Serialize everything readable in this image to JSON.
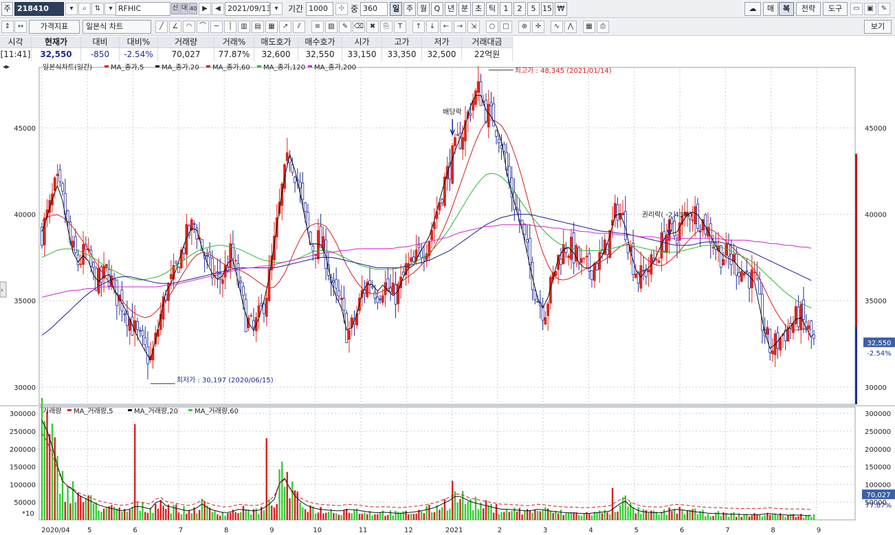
{
  "toolbar": {
    "market_label": "주",
    "code": "218410",
    "name": "RFHIC",
    "name_tags": [
      "신",
      "대",
      "40"
    ],
    "date": "2021/09/13",
    "period_label": "기간",
    "period_value": "1000",
    "count_label": "중",
    "count_value": "360",
    "intervals": [
      "일",
      "주",
      "월",
      "Q",
      "년",
      "분",
      "초",
      "틱",
      "1",
      "2",
      "5",
      "15",
      "₩"
    ],
    "active_interval": "일",
    "right_buttons": [
      "매",
      "복",
      "전략",
      "도구"
    ],
    "icons": [
      "search-icon",
      "sort-icon",
      "dropdown-icon",
      "play-icon",
      "prev-icon",
      "dropdown-icon",
      "spin-icon",
      "cloud-icon",
      "folder-icon",
      "save-icon",
      "settings-icon"
    ]
  },
  "toolbar2": {
    "chart_type": "가격지표",
    "chart_style": "일본식 차트",
    "view_label": "보기",
    "tool_icons": [
      "line-tool-icon",
      "angle-tool-icon",
      "fan-tool-icon",
      "arc-tool-icon",
      "hline-icon",
      "vline-icon",
      "grid-icon",
      "cycle-icon",
      "channel-icon",
      "ray-icon",
      "parallel-icon",
      "multi-line-icon",
      "fibo-icon",
      "pencil-icon",
      "eraser-icon",
      "delete-icon",
      "copy-icon",
      "text-icon",
      "up-arrow-icon",
      "down-arrow-icon",
      "left-arrow-icon",
      "right-arrow-icon",
      "export-icon",
      "circle-icon",
      "rect-icon",
      "zoom-icon",
      "crosshair-icon",
      "wave-icon",
      "pattern-icon",
      "print-icon",
      "print-preview-icon"
    ]
  },
  "quote": {
    "headers": [
      "시각",
      "현재가",
      "대비",
      "대비%",
      "거래량",
      "거래%",
      "매도호가",
      "매수호가",
      "시가",
      "고가",
      "저가",
      "거래대금"
    ],
    "values": [
      "[11:41]",
      "32,550",
      "-850",
      "-2.54%",
      "70,027",
      "77.87%",
      "32,600",
      "32,550",
      "33,150",
      "33,350",
      "32,500",
      "22억원"
    ]
  },
  "colors": {
    "up": "#e0241a",
    "down": "#1b2c9c",
    "ma5": "#d21e1e",
    "ma20": "#111111",
    "ma60": "#c0161a",
    "ma120": "#2ab82a",
    "ma200": "#1a1a8c",
    "ma_pink": "#d322d3",
    "vol_up": "#d82020",
    "vol_down": "#33cc33"
  },
  "price_legend": {
    "title": "일본식차트(일간)",
    "items": [
      "MA_종가,5",
      "MA_종가,20",
      "MA_종가,60",
      "MA_종가,120",
      "MA_종가,200"
    ]
  },
  "volume_legend": {
    "title": "거래량",
    "items": [
      "MA_거래량,5",
      "MA_거래량,20",
      "MA_거래량,60"
    ]
  },
  "chart_data": {
    "type": "candlestick",
    "price_axis": {
      "ticks": [
        30000,
        35000,
        40000,
        45000
      ],
      "labels": [
        "30000",
        "35000",
        "40000",
        "45000"
      ],
      "ylim": [
        29000,
        48500
      ]
    },
    "volume_axis": {
      "ticks": [
        50000,
        100000,
        150000,
        200000,
        250000,
        300000
      ],
      "labels": [
        "50000",
        "100000",
        "150000",
        "200000",
        "250000",
        "300000"
      ],
      "ylim": [
        0,
        310000
      ],
      "multiplier_label": "*10"
    },
    "x_labels": [
      "2020/04",
      "5",
      "6",
      "7",
      "8",
      "9",
      "10",
      "11",
      "12",
      "2021",
      "2",
      "3",
      "4",
      "5",
      "6",
      "7",
      "8",
      "9"
    ],
    "close_path": [
      39000,
      40200,
      41800,
      40600,
      38000,
      37200,
      37800,
      36500,
      36000,
      36800,
      35500,
      34900,
      34000,
      33000,
      32200,
      31500,
      33500,
      35500,
      36200,
      37600,
      38800,
      39500,
      38000,
      36800,
      36200,
      36500,
      37800,
      36000,
      34000,
      33200,
      34200,
      35800,
      38500,
      41500,
      43500,
      42200,
      40000,
      38000,
      38500,
      37600,
      35500,
      34800,
      33000,
      33800,
      35500,
      36200,
      35500,
      36000,
      35200,
      35600,
      36800,
      37000,
      37900,
      38500,
      39800,
      41500,
      42800,
      44000,
      45000,
      46500,
      47200,
      46000,
      45500,
      44500,
      42000,
      40500,
      39000,
      37000,
      35200,
      34400,
      36000,
      37600,
      38200,
      37800,
      37000,
      36800,
      37200,
      37500,
      38800,
      40400,
      39500,
      37500,
      36200,
      36800,
      37200,
      38200,
      39000,
      38800,
      39600,
      40200,
      40000,
      39400,
      38600,
      37800,
      37500,
      37300,
      36800,
      36500,
      36000,
      33500,
      32200,
      32600,
      33200,
      33600,
      34200,
      33400,
      32550
    ],
    "ma20": [
      39600,
      39900,
      40000,
      39800,
      39400,
      38800,
      38200,
      37500,
      36800,
      36200,
      35600,
      35000,
      34500,
      34200,
      34000,
      34100,
      34500,
      35000,
      35600,
      36300,
      37000,
      37600,
      37800,
      37700,
      37400,
      37100,
      36900,
      36800,
      36600,
      36300,
      36000,
      35700,
      35800,
      36300,
      37200,
      38200,
      39000,
      39400,
      39500,
      39300,
      38700,
      37800,
      36900,
      36200,
      35700,
      35400,
      35400,
      35600,
      35800,
      36000,
      36300,
      36600,
      37000,
      37500,
      38200,
      39000,
      40000,
      41200,
      42400,
      43600,
      44700,
      45400,
      45500,
      45200,
      44500,
      43400,
      42000,
      40400,
      38800,
      37500,
      36600,
      36200,
      36200,
      36400,
      36700,
      36900,
      37100,
      37300,
      37600,
      38000,
      38300,
      38200,
      37800,
      37400,
      37100,
      37000,
      37200,
      37600,
      38100,
      38600,
      39000,
      39200,
      39100,
      38800,
      38400,
      38000,
      37600,
      37200,
      36700,
      35900,
      35000,
      34200,
      33600,
      33300,
      33300,
      33400,
      33300
    ],
    "ma60": [
      37500,
      37700,
      37900,
      38000,
      38000,
      37900,
      37700,
      37500,
      37200,
      36900,
      36700,
      36500,
      36300,
      36200,
      36200,
      36300,
      36400,
      36600,
      36900,
      37200,
      37500,
      37800,
      38000,
      38100,
      38200,
      38200,
      38100,
      38000,
      37800,
      37600,
      37400,
      37300,
      37200,
      37200,
      37300,
      37400,
      37600,
      37800,
      37900,
      37900,
      37800,
      37600,
      37400,
      37200,
      37000,
      36900,
      36800,
      36800,
      36800,
      36900,
      37000,
      37200,
      37400,
      37700,
      38100,
      38600,
      39200,
      39900,
      40600,
      41300,
      41900,
      42300,
      42400,
      42200,
      41800,
      41200,
      40600,
      40000,
      39500,
      39000,
      38600,
      38300,
      38100,
      38000,
      37900,
      37900,
      37900,
      37900,
      38000,
      38100,
      38200,
      38200,
      38100,
      38000,
      37900,
      37800,
      37800,
      37800,
      37900,
      38000,
      38100,
      38200,
      38200,
      38100,
      38000,
      37800,
      37600,
      37400,
      37100,
      36700,
      36300,
      35900,
      35500,
      35200,
      34900,
      34700,
      34500
    ],
    "ma120": [
      33000,
      33300,
      33700,
      34100,
      34500,
      34900,
      35300,
      35600,
      35900,
      36100,
      36300,
      36400,
      36400,
      36300,
      36200,
      36100,
      36000,
      36000,
      36000,
      36100,
      36200,
      36300,
      36400,
      36500,
      36600,
      36700,
      36800,
      36900,
      36900,
      36900,
      36900,
      36900,
      36900,
      37000,
      37100,
      37200,
      37300,
      37400,
      37500,
      37500,
      37500,
      37400,
      37300,
      37200,
      37100,
      37000,
      36900,
      36900,
      36900,
      36900,
      37000,
      37100,
      37200,
      37300,
      37500,
      37700,
      37900,
      38200,
      38500,
      38800,
      39100,
      39400,
      39600,
      39800,
      39900,
      40000,
      40000,
      40000,
      39900,
      39800,
      39700,
      39600,
      39500,
      39400,
      39300,
      39200,
      39100,
      39000,
      39000,
      38900,
      38900,
      38800,
      38700,
      38600,
      38500,
      38400,
      38300,
      38200,
      38200,
      38200,
      38300,
      38400,
      38400,
      38400,
      38300,
      38200,
      38000,
      37900,
      37700,
      37500,
      37300,
      37100,
      36900,
      36700,
      36500,
      36300,
      36100
    ],
    "ma200": [
      35200,
      35300,
      35400,
      35500,
      35600,
      35600,
      35700,
      35700,
      35800,
      35800,
      35800,
      35800,
      35800,
      35800,
      35800,
      35800,
      35800,
      35900,
      35900,
      36000,
      36100,
      36200,
      36300,
      36400,
      36500,
      36600,
      36700,
      36800,
      36900,
      36900,
      37000,
      37000,
      37100,
      37200,
      37300,
      37400,
      37500,
      37600,
      37700,
      37800,
      37800,
      37900,
      37900,
      38000,
      38000,
      38000,
      38000,
      38000,
      38000,
      38100,
      38100,
      38200,
      38300,
      38400,
      38500,
      38600,
      38700,
      38900,
      39000,
      39100,
      39200,
      39300,
      39300,
      39400,
      39400,
      39400,
      39400,
      39400,
      39300,
      39300,
      39200,
      39200,
      39100,
      39100,
      39000,
      39000,
      38900,
      38900,
      38900,
      38800,
      38800,
      38800,
      38700,
      38700,
      38700,
      38600,
      38600,
      38600,
      38600,
      38600,
      38600,
      38600,
      38600,
      38600,
      38500,
      38500,
      38500,
      38500,
      38400,
      38400,
      38300,
      38300,
      38200,
      38200,
      38100,
      38100,
      38000
    ],
    "volume_path": [
      280000,
      240000,
      160000,
      100000,
      90000,
      70000,
      60000,
      50000,
      40000,
      35000,
      30000,
      25000,
      30000,
      40000,
      35000,
      30000,
      60000,
      40000,
      35000,
      30000,
      25000,
      30000,
      45000,
      30000,
      25000,
      20000,
      22000,
      30000,
      28000,
      25000,
      28000,
      40000,
      60000,
      130000,
      90000,
      60000,
      45000,
      35000,
      30000,
      28000,
      26000,
      25000,
      30000,
      28000,
      25000,
      22000,
      20000,
      22000,
      20000,
      18000,
      20000,
      22000,
      25000,
      30000,
      35000,
      45000,
      55000,
      70000,
      60000,
      50000,
      45000,
      40000,
      35000,
      30000,
      30000,
      28000,
      26000,
      25000,
      30000,
      28000,
      24000,
      22000,
      20000,
      20000,
      18000,
      18000,
      20000,
      22000,
      25000,
      40000,
      55000,
      35000,
      25000,
      22000,
      20000,
      20000,
      25000,
      30000,
      28000,
      25000,
      22000,
      20000,
      18000,
      18000,
      16000,
      16000,
      15000,
      15000,
      14000,
      16000,
      18000,
      15000,
      14000,
      13000,
      14000,
      12000,
      12000
    ],
    "spikes": [
      {
        "x": 13,
        "v": 270000
      },
      {
        "x": 31,
        "v": 230000
      },
      {
        "x": 34,
        "v": 135000
      },
      {
        "x": 57,
        "v": 110000
      },
      {
        "x": 79,
        "v": 90000
      }
    ],
    "annotations": {
      "high": "최고가 : 48,345 (2021/01/14)",
      "low": "최저가 : 30,197 (2020/06/15)",
      "dividend": "배당락",
      "rights": "권리락( -2.43%)"
    },
    "current_price_label": "32,550",
    "current_change_label": "-2.54%",
    "current_volume_label": "70,027",
    "current_volume_pct_label": "77.87%"
  }
}
